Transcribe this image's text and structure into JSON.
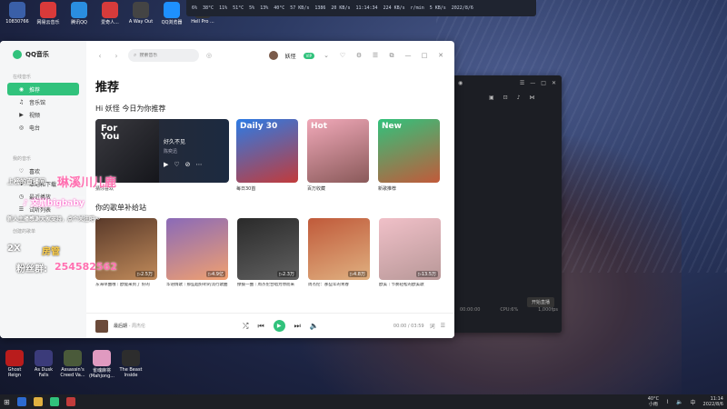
{
  "desktop": {
    "top_icons": [
      {
        "label": "10830766",
        "color": "#3a5fa8"
      },
      {
        "label": "网易云音乐",
        "color": "#d93a3a"
      },
      {
        "label": "腾讯QQ",
        "color": "#2a8ee0"
      },
      {
        "label": "爱奇人...",
        "color": "#d63b3b"
      },
      {
        "label": "A Way Out",
        "color": "#444"
      },
      {
        "label": "QQ浏览器",
        "color": "#1e90ff"
      },
      {
        "label": "Hell Pro ...",
        "color": "#333"
      }
    ],
    "bottom_icons": [
      {
        "label": "Ghost Reign",
        "color": "#b91c1c"
      },
      {
        "label": "As Dusk Falls",
        "color": "#3b3b7a"
      },
      {
        "label": "Assassin's Creed Va...",
        "color": "#4a5a3a"
      },
      {
        "label": "雀魂麻将 (Mahjong...",
        "color": "#e09ac0"
      },
      {
        "label": "The Beast Inside",
        "color": "#2d2d2d"
      }
    ]
  },
  "sysbar": {
    "items": [
      "6%",
      "38°C",
      "11%",
      "51°C",
      "5%",
      "13%",
      "40°C",
      "57 KB/s",
      "1386",
      "20 KB/s",
      "11:14:34",
      "224 KB/s",
      "r/min",
      "5 KB/s",
      "2022/8/6"
    ]
  },
  "app": {
    "name": "QQ音乐",
    "search_placeholder": "搜索音乐",
    "username": "妖怪",
    "vip": "VIP",
    "sidebar": {
      "section1": "在线音乐",
      "items1": [
        {
          "label": "推荐",
          "icon": "home-icon",
          "active": true
        },
        {
          "label": "音乐馆",
          "icon": "music-note-icon",
          "active": false
        },
        {
          "label": "视频",
          "icon": "video-icon",
          "active": false
        },
        {
          "label": "电台",
          "icon": "radio-icon",
          "active": false
        }
      ],
      "section2": "我的音乐",
      "items2": [
        {
          "label": "喜欢",
          "icon": "heart-icon"
        },
        {
          "label": "本地和下载",
          "icon": "download-icon"
        },
        {
          "label": "最近播放",
          "icon": "clock-icon"
        },
        {
          "label": "试听列表",
          "icon": "list-icon"
        }
      ],
      "section3": "创建的歌单"
    },
    "page_title": "推荐",
    "greeting": "Hi 妖怪 今日为你推荐",
    "featured": {
      "tag": "For You",
      "song": "好久不见",
      "artist": "陈奕迅",
      "caption": "猜你喜欢"
    },
    "rec_cards": [
      {
        "tag": "Daily 30",
        "caption": "每日30首",
        "color1": "#2c7be5",
        "color2": "#c23b3b"
      },
      {
        "tag": "Hot",
        "caption": "百万收藏",
        "color1": "#f0a8b8",
        "color2": "#8a5a5a"
      },
      {
        "tag": "New",
        "caption": "新歌推荐",
        "color1": "#31c27c",
        "color2": "#c25a3a"
      }
    ],
    "section2_title": "你的歌单补给站",
    "playlists": [
      {
        "count": "2.5万",
        "caption": "东海单曲哦｜欧能来到了 好的",
        "color1": "#5a3a2a",
        "color2": "#c08a5a"
      },
      {
        "count": "4.9亿",
        "caption": "华语情歌｜那些超好听的流行歌曲",
        "color1": "#8a6ab8",
        "color2": "#f0a070"
      },
      {
        "count": "2.3万",
        "caption": "撩拨一曲｜周杰伦合唱为你而来",
        "color1": "#2a2a2a",
        "color2": "#606060"
      },
      {
        "count": "4.8万",
        "caption": "周杰伦：那些年的青春",
        "color1": "#c05a3a",
        "color2": "#e0b080"
      },
      {
        "count": "13.5万",
        "caption": "欧美｜节奏轻松的欧美歌",
        "color1": "#f0c0c8",
        "color2": "#b89898"
      }
    ],
    "player": {
      "song": "最后期",
      "artist": "周杰伦",
      "time": "00:00 / 03:59",
      "icons": [
        "shuffle-icon",
        "prev-icon",
        "play-icon",
        "next-icon",
        "volume-icon"
      ]
    }
  },
  "side_window": {
    "footer": [
      "00:00:00",
      "CPU:6%",
      "1,000fps"
    ],
    "action": "开始直播"
  },
  "overlay": {
    "line1": "上榜的直播间",
    "name1": "琳溪川儿鹿",
    "tiktok": "文崩bigbaby",
    "line3": "新人主播感谢大家支持，点个关注吧～",
    "badge": "2X",
    "room": "房管",
    "fans_label": "粉丝群:",
    "fans_number": "254582562"
  },
  "taskbar": {
    "temp": "40°C",
    "weather": "小雨",
    "time": "11:14",
    "date": "2022/8/6"
  }
}
